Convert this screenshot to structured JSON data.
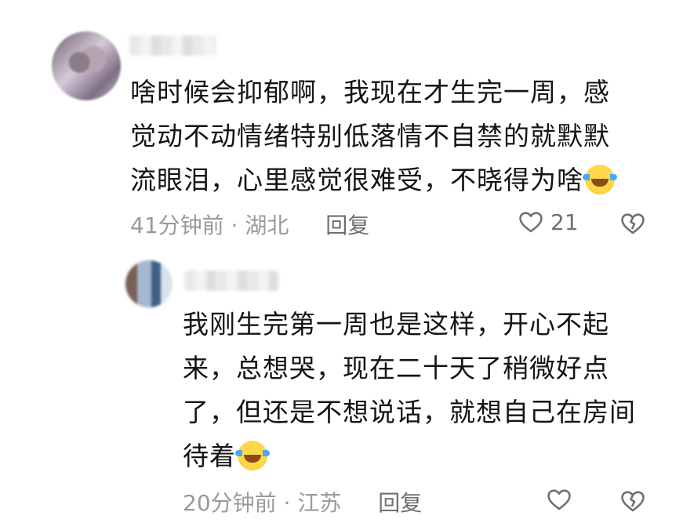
{
  "comments": [
    {
      "text_lines": [
        "啥时候会抑郁啊，我现在才生完一周，感",
        "觉动不动情绪特别低落情不自禁的就默默",
        "流眼泪，心里感觉很难受，不晓得为啥"
      ],
      "emoji": "crying-laughing-emoji",
      "time": "41分钟前",
      "location": "湖北",
      "reply_label": "回复",
      "like_count": "21"
    },
    {
      "text_lines": [
        "我刚生完第一周也是这样，开心不起",
        "来，总想哭，现在二十天了稍微好点",
        "了，但还是不想说话，就想自己在房间",
        "待着"
      ],
      "emoji": "rolling-laughing-emoji",
      "time": "20分钟前",
      "location": "江苏",
      "reply_label": "回复",
      "like_count": ""
    }
  ],
  "meta_separator": " · ",
  "colors": {
    "text": "#141414",
    "meta": "#9a9a9a",
    "icon": "#6f6f6f"
  }
}
